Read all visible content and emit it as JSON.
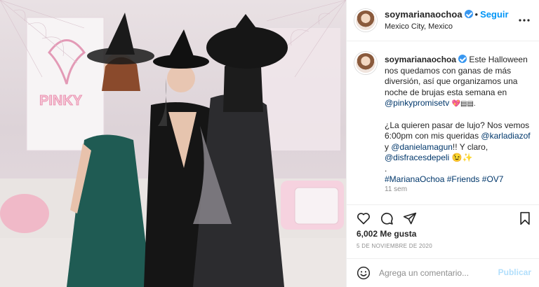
{
  "post": {
    "image_alt": "Three women dressed as witches",
    "sign_text": "PINKY",
    "header": {
      "username": "soymarianaochoa",
      "follow_label": "Seguir",
      "separator": "•",
      "location": "Mexico City, Mexico",
      "more_icon": "more-options-icon"
    },
    "caption": {
      "username": "soymarianaochoa",
      "line1": "Este Halloween nos quedamos con ganas de más diversión, así que organizamos una noche de brujas esta semana en ",
      "mention1": "@pinkypromisetv",
      "emoji1": "💖▤▤.",
      "line2": "¿La quieren pasar de lujo? Nos vemos 6:00pm con mis queridas ",
      "mention2": "@karladiazof",
      "y": " y ",
      "mention3": "@danielamagun",
      "line3": "!! Y claro, ",
      "mention4": "@disfracesdepeli",
      "emoji2": " 😉✨",
      "period": ".",
      "hashtag1": "#MarianaOchoa",
      "hashtag2": "#Friends",
      "hashtag3": "#OV7",
      "time_ago": "11 sem"
    },
    "likes": "6,002 Me gusta",
    "date": "5 DE NOVIEMBRE DE 2020",
    "comment_placeholder": "Agrega un comentario...",
    "post_label": "Publicar"
  }
}
